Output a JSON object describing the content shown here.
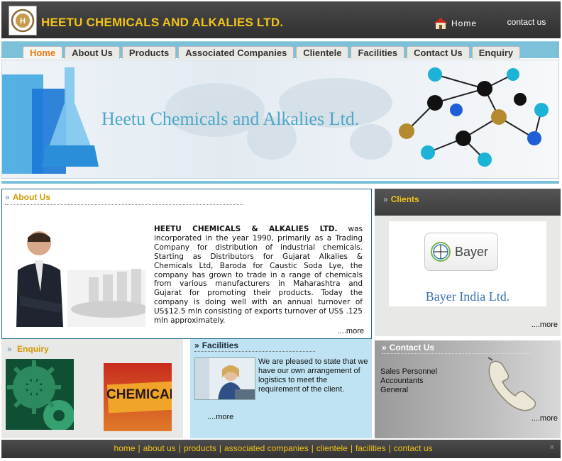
{
  "header": {
    "company_name": "HEETU CHEMICALS AND ALKALIES LTD.",
    "home_label": "Home",
    "contact_label": "contact us"
  },
  "nav": {
    "tabs": [
      {
        "label": "Home"
      },
      {
        "label": "About Us"
      },
      {
        "label": "Products"
      },
      {
        "label": "Associated Companies"
      },
      {
        "label": "Clientele"
      },
      {
        "label": "Facilities"
      },
      {
        "label": "Contact Us"
      },
      {
        "label": "Enquiry"
      }
    ],
    "active_index": 0
  },
  "banner": {
    "title": "Heetu Chemicals and Alkalies Ltd."
  },
  "about": {
    "heading": "About Us",
    "company_bold": "HEETU CHEMICALS & ALKALIES LTD.",
    "body": "was incorporated in the year 1990, primarily as a Trading Company for distribution of industrial chemicals. Starting as Distributors for Gujarat Alkalies & Chemicals Ltd, Baroda for Caustic Soda Lye, the company has grown to trade in a range of chemicals from various manufacturers in Maharashtra and Gujarat for promoting their products. Today the company is doing well with an annual turnover of US$12.5 mln consisting of exports turnover of US$ .125 mln approximately.",
    "more": "....more"
  },
  "clients": {
    "heading": "Clients",
    "logo_word": "Bayer",
    "client_name": "Bayer India Ltd.",
    "more": "....more"
  },
  "enquiry": {
    "heading": "Enquiry",
    "label_image": "CHEMICALS"
  },
  "facilities": {
    "heading": "Facilities",
    "body": "We are pleased to state that we have our own arrangement of logistics to meet the requirement of the client.",
    "more": "....more"
  },
  "contact": {
    "heading": "Contact Us",
    "items": [
      "Sales Personnel",
      "Accountants",
      "General"
    ],
    "more": "....more"
  },
  "footer": {
    "links": [
      "home",
      "about us",
      "products",
      "associated companies",
      "clientele",
      "facilities",
      "contact us"
    ]
  },
  "colors": {
    "title_gold": "#f3c31a",
    "nav_blue": "#7cc0d9",
    "active_tab": "#e57b16",
    "banner_text": "#4ea7c7"
  },
  "icons": {
    "logo": "hca-logo",
    "home": "house-icon",
    "chevron": "double-chevron-icon",
    "phone": "telephone-icon"
  }
}
